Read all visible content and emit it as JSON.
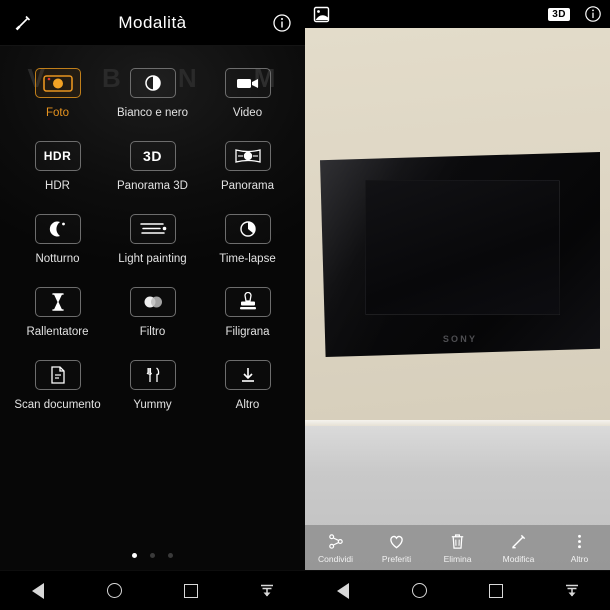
{
  "left_panel": {
    "topbar": {
      "wand_icon": "magic-wand-icon",
      "title": "Modalità",
      "info_icon": "info-icon"
    },
    "watermark_letters": [
      "V",
      "B",
      "N",
      "M"
    ],
    "modes": [
      {
        "label": "Foto",
        "icon": "camera-icon",
        "selected": true,
        "icon_text": ""
      },
      {
        "label": "Bianco e nero",
        "icon": "contrast-icon",
        "selected": false,
        "icon_text": ""
      },
      {
        "label": "Video",
        "icon": "camcorder-icon",
        "selected": false,
        "icon_text": ""
      },
      {
        "label": "HDR",
        "icon": "hdr-icon",
        "selected": false,
        "icon_text": "HDR"
      },
      {
        "label": "Panorama 3D",
        "icon": "panorama-3d-icon",
        "selected": false,
        "icon_text": "3D"
      },
      {
        "label": "Panorama",
        "icon": "panorama-icon",
        "selected": false,
        "icon_text": ""
      },
      {
        "label": "Notturno",
        "icon": "moon-icon",
        "selected": false,
        "icon_text": ""
      },
      {
        "label": "Light painting",
        "icon": "light-painting-icon",
        "selected": false,
        "icon_text": ""
      },
      {
        "label": "Time-lapse",
        "icon": "time-lapse-icon",
        "selected": false,
        "icon_text": ""
      },
      {
        "label": "Rallentatore",
        "icon": "hourglass-icon",
        "selected": false,
        "icon_text": ""
      },
      {
        "label": "Filtro",
        "icon": "filter-icon",
        "selected": false,
        "icon_text": ""
      },
      {
        "label": "Filigrana",
        "icon": "stamp-icon",
        "selected": false,
        "icon_text": ""
      },
      {
        "label": "Scan documento",
        "icon": "document-scan-icon",
        "selected": false,
        "icon_text": ""
      },
      {
        "label": "Yummy",
        "icon": "cutlery-icon",
        "selected": false,
        "icon_text": ""
      },
      {
        "label": "Altro",
        "icon": "download-icon",
        "selected": false,
        "icon_text": ""
      }
    ],
    "pager": {
      "total": 3,
      "active_index": 0
    },
    "accent_color": "#e8941f"
  },
  "right_panel": {
    "topbar": {
      "image_icon": "picture-icon",
      "badge_3d": "3D",
      "info_icon": "info-icon"
    },
    "photo": {
      "subject": "sony-digital-photo-frame",
      "brand_text": "SONY",
      "wall_color": "#ded6c4",
      "table_color": "#c8c8c8",
      "frame_color": "#0b0b0d"
    },
    "toolbar": [
      {
        "label": "Condividi",
        "icon": "share-icon"
      },
      {
        "label": "Preferiti",
        "icon": "heart-icon"
      },
      {
        "label": "Elimina",
        "icon": "trash-icon"
      },
      {
        "label": "Modifica",
        "icon": "edit-pencil-icon"
      },
      {
        "label": "Altro",
        "icon": "more-vertical-icon"
      }
    ]
  },
  "navbar": {
    "back": "back-triangle-icon",
    "home": "home-circle-icon",
    "recents": "recents-square-icon",
    "hide": "hide-navbar-icon"
  }
}
